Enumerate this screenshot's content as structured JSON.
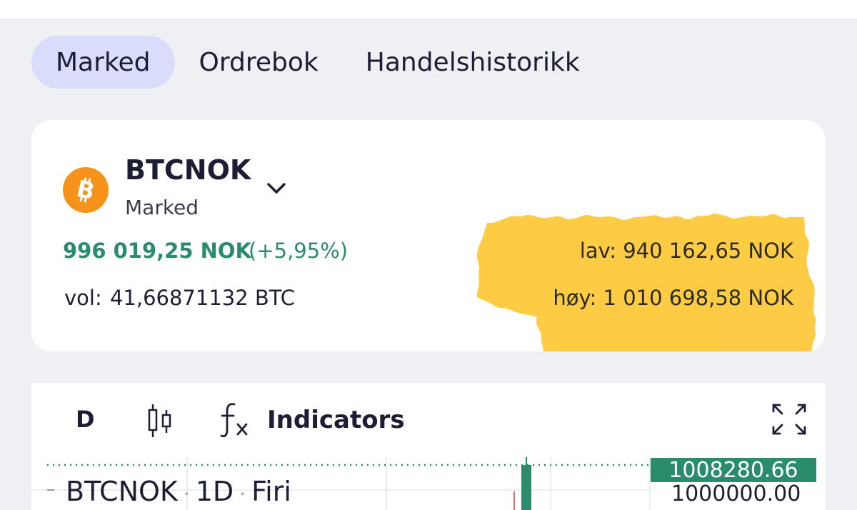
{
  "tabs": [
    {
      "label": "Marked",
      "active": true
    },
    {
      "label": "Ordrebok",
      "active": false
    },
    {
      "label": "Handelshistorikk",
      "active": false
    }
  ],
  "market": {
    "pair": "BTCNOK",
    "type": "Marked",
    "coin_icon": "bitcoin-icon",
    "price": "996 019,25 NOK",
    "change": "(+5,95%)",
    "vol_label": "vol:",
    "vol_value": "41,66871132 BTC",
    "low_label": "lav:",
    "low_value": "940 162,65 NOK",
    "high_label": "høy:",
    "high_value": "1 010 698,58 NOK"
  },
  "chart_toolbar": {
    "interval": "D",
    "indicators_label": "Indicators"
  },
  "chart": {
    "symbol": "BTCNOK",
    "interval": "1D",
    "exchange": "Firi",
    "separator": "·",
    "current_price_tag": "1008280.66",
    "price_level": "1000000.00"
  },
  "colors": {
    "accent_green": "#2a8c6d",
    "tab_active_bg": "#d9dcfb",
    "bitcoin_orange": "#f7931a",
    "highlight_yellow": "#fdc93a"
  }
}
